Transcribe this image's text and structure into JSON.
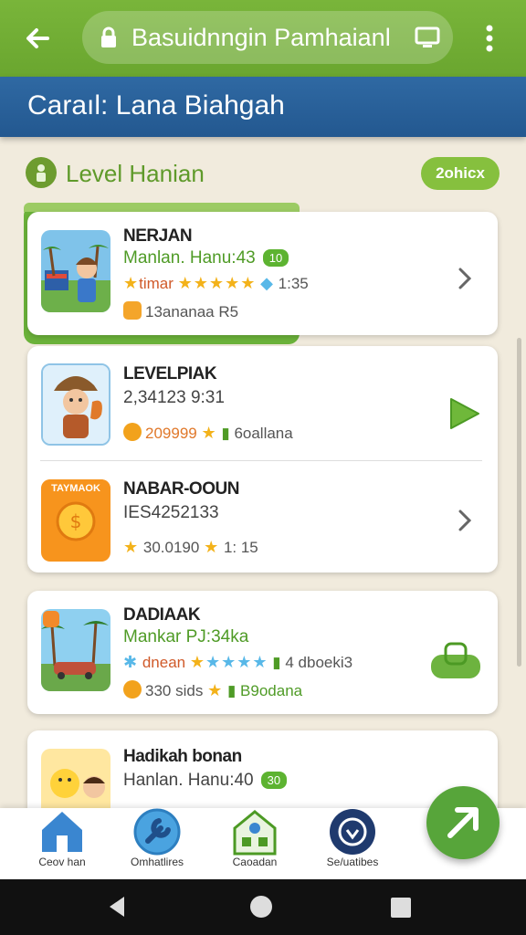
{
  "browser": {
    "url": "Basuidnngin Pamhaianl"
  },
  "header": {
    "title": "Caraıl: Lana Biahgah"
  },
  "section": {
    "title": "Level Hanian",
    "pill": "2ohicx"
  },
  "cards": [
    {
      "name": "NERJAN",
      "subtitle": "Manlan. Hanu:43",
      "badge": "10",
      "rating_prefix": "timar",
      "rating_value": "1:35",
      "meta": "13ananaa R5",
      "action": "chevron-right"
    },
    {
      "name": "LEVELPIAK",
      "subtitle": "2,34123 9:31",
      "coins": "209999",
      "meta_tail": "6oallana",
      "action": "play"
    },
    {
      "name": "NABAR-OOUN",
      "subtitle": "IES4252133",
      "thumb_text": "TAYMAOK",
      "rating_value": "30.0190",
      "rating_value2": "1: 15",
      "action": "chevron-right"
    },
    {
      "name": "DADIAAK",
      "subtitle": "Mankar PJ:34ka",
      "rating_prefix": "dnean",
      "rating_value": "4 dboeki3",
      "coins": "330 sids",
      "meta_tail": "B9odana",
      "action": "bag"
    },
    {
      "name": "Hadikah bonan",
      "subtitle": "Hanlan. Hanu:40",
      "badge": "30"
    }
  ],
  "bottom_nav": [
    {
      "label": "Ceov han",
      "icon": "home-icon"
    },
    {
      "label": "Omhatlires",
      "icon": "wrench-icon"
    },
    {
      "label": "Caoadan",
      "icon": "school-icon"
    },
    {
      "label": "Se/uatibes",
      "icon": "shield-icon"
    }
  ],
  "colors": {
    "topbar": "#79b53a",
    "title_band": "#2f69a3",
    "accent_green": "#57a53a",
    "star": "#f3b21a"
  }
}
